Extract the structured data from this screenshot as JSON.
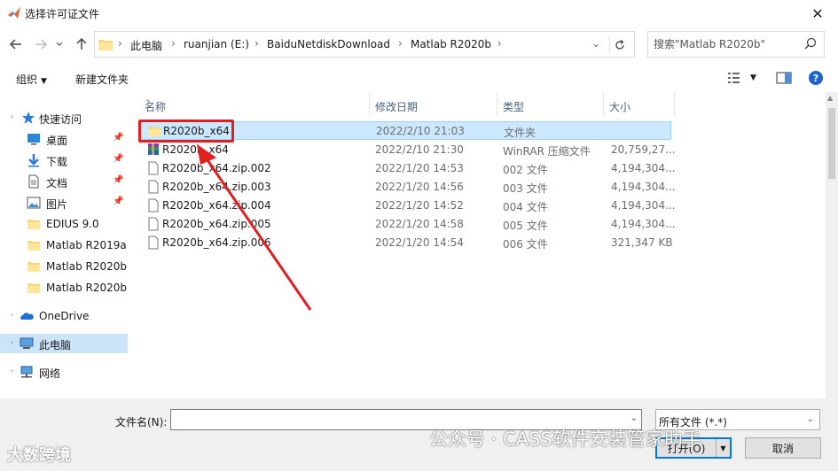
{
  "window": {
    "title": "选择许可证文件",
    "close_glyph": "✕"
  },
  "address": {
    "crumbs": [
      "此电脑",
      "ruanjian (E:)",
      "BaiduNetdiskDownload",
      "Matlab R2020b"
    ],
    "separator": "›",
    "search_placeholder": "搜索\"Matlab R2020b\""
  },
  "toolbar": {
    "organize": "组织",
    "new_folder": "新建文件夹"
  },
  "sidebar": {
    "quick_access": "快速访问",
    "items": [
      {
        "label": "桌面",
        "pinned": true
      },
      {
        "label": "下载",
        "pinned": true
      },
      {
        "label": "文档",
        "pinned": true
      },
      {
        "label": "图片",
        "pinned": true
      },
      {
        "label": "EDIUS 9.0"
      },
      {
        "label": "Matlab R2019a"
      },
      {
        "label": "Matlab R2020b"
      },
      {
        "label": "Matlab R2020b"
      }
    ],
    "onedrive": "OneDrive",
    "this_pc": "此电脑",
    "network": "网络"
  },
  "columns": {
    "name": "名称",
    "date": "修改日期",
    "type": "类型",
    "size": "大小"
  },
  "files": [
    {
      "name": "R2020b_x64",
      "date": "2022/2/10 21:03",
      "type": "文件夹",
      "size": "",
      "icon": "folder-icon"
    },
    {
      "name": "R2020b_x64",
      "date": "2022/2/10 21:30",
      "type": "WinRAR 压缩文件",
      "size": "20,759,27...",
      "icon": "winrar-icon"
    },
    {
      "name": "R2020b_x64.zip.002",
      "date": "2022/1/20 14:53",
      "type": "002 文件",
      "size": "4,194,304...",
      "icon": "file-icon"
    },
    {
      "name": "R2020b_x64.zip.003",
      "date": "2022/1/20 14:56",
      "type": "003 文件",
      "size": "4,194,304...",
      "icon": "file-icon"
    },
    {
      "name": "R2020b_x64.zip.004",
      "date": "2022/1/20 14:52",
      "type": "004 文件",
      "size": "4,194,304...",
      "icon": "file-icon"
    },
    {
      "name": "R2020b_x64.zip.005",
      "date": "2022/1/20 14:58",
      "type": "005 文件",
      "size": "4,194,304...",
      "icon": "file-icon"
    },
    {
      "name": "R2020b_x64.zip.006",
      "date": "2022/1/20 14:54",
      "type": "006 文件",
      "size": "321,347 KB",
      "icon": "file-icon"
    }
  ],
  "bottom": {
    "filename_label": "文件名(N):",
    "filename_value": "",
    "filter": "所有文件 (*.*)",
    "open": "打开(O)",
    "cancel": "取消"
  },
  "watermarks": {
    "left": "大数跨境",
    "right": "公众号 · CASS软件安装管家助手"
  },
  "colors": {
    "highlight": "#e02020",
    "selection": "#cce8ff",
    "accent": "#0078d7"
  }
}
